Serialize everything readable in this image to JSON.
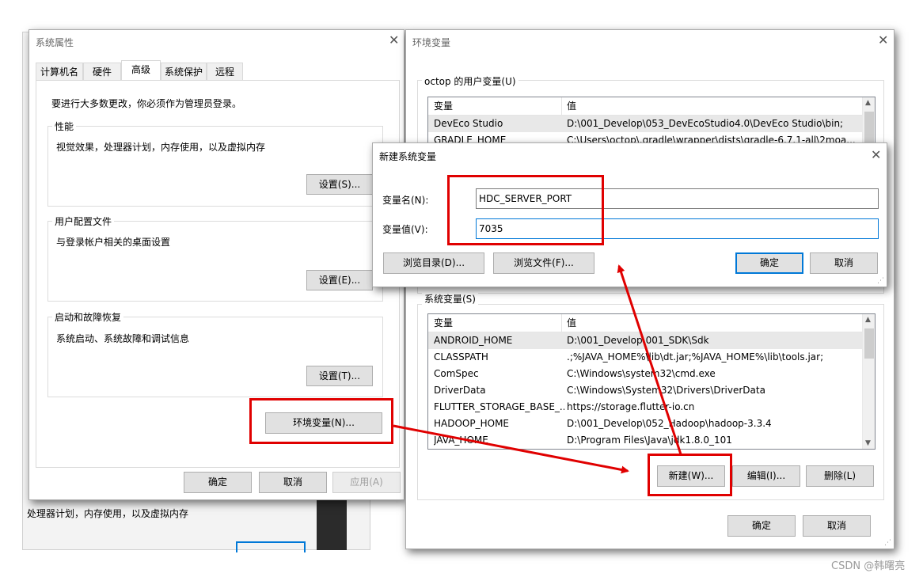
{
  "sys_props": {
    "title": "系统属性",
    "tabs": [
      "计算机名",
      "硬件",
      "高级",
      "系统保护",
      "远程"
    ],
    "admin_note": "要进行大多数更改，你必须作为管理员登录。",
    "performance": {
      "label": "性能",
      "desc": "视觉效果，处理器计划，内存使用，以及虚拟内存",
      "button": "设置(S)..."
    },
    "profiles": {
      "label": "用户配置文件",
      "desc": "与登录帐户相关的桌面设置",
      "button": "设置(E)..."
    },
    "startup": {
      "label": "启动和故障恢复",
      "desc": "系统启动、系统故障和调试信息",
      "button": "设置(T)..."
    },
    "env_button": "环境变量(N)...",
    "ok": "确定",
    "cancel": "取消",
    "apply": "应用(A)"
  },
  "behind_text": "处理器计划，内存使用，以及虚拟内存",
  "env_vars": {
    "title": "环境变量",
    "user_group": "octop 的用户变量(U)",
    "col_var": "变量",
    "col_val": "值",
    "user_rows": [
      {
        "name": "DevEco Studio",
        "value": "D:\\001_Develop\\053_DevEcoStudio4.0\\DevEco Studio\\bin;"
      },
      {
        "name": "GRADLE_HOME",
        "value": "C:\\Users\\octop\\.gradle\\wrapper\\dists\\gradle-6.7.1-all\\2moa..."
      }
    ],
    "sys_group": "系统变量(S)",
    "sys_rows": [
      {
        "name": "ANDROID_HOME",
        "value": "D:\\001_Develop\\001_SDK\\Sdk"
      },
      {
        "name": "CLASSPATH",
        "value": ".;%JAVA_HOME%\\lib\\dt.jar;%JAVA_HOME%\\lib\\tools.jar;"
      },
      {
        "name": "ComSpec",
        "value": "C:\\Windows\\system32\\cmd.exe"
      },
      {
        "name": "DriverData",
        "value": "C:\\Windows\\System32\\Drivers\\DriverData"
      },
      {
        "name": "FLUTTER_STORAGE_BASE_...",
        "value": "https://storage.flutter-io.cn"
      },
      {
        "name": "HADOOP_HOME",
        "value": "D:\\001_Develop\\052_Hadoop\\hadoop-3.3.4"
      },
      {
        "name": "JAVA_HOME",
        "value": "D:\\Program Files\\Java\\jdk1.8.0_101"
      }
    ],
    "new_btn": "新建(W)...",
    "edit_btn": "编辑(I)...",
    "delete_btn": "删除(L)",
    "ok": "确定",
    "cancel": "取消"
  },
  "new_var_dialog": {
    "title": "新建系统变量",
    "name_label": "变量名(N):",
    "name_value": "HDC_SERVER_PORT",
    "value_label": "变量值(V):",
    "value_value": "7035",
    "browse_dir": "浏览目录(D)...",
    "browse_file": "浏览文件(F)...",
    "ok": "确定",
    "cancel": "取消"
  },
  "watermark": "CSDN @韩曙亮",
  "colors": {
    "highlight": "#e00000",
    "accent": "#0078d7"
  }
}
